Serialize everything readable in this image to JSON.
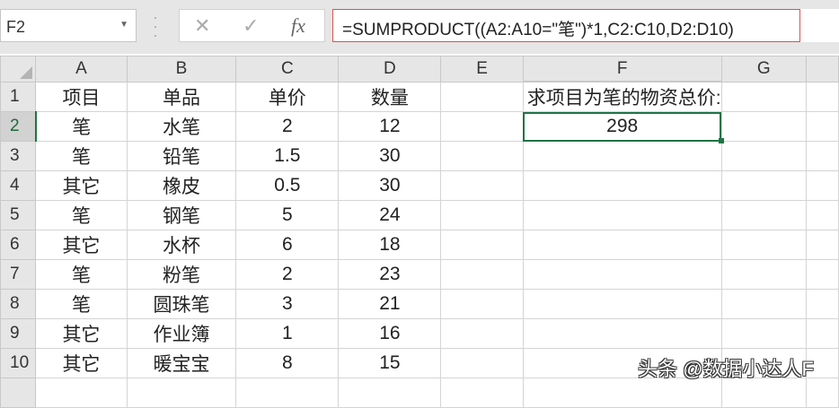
{
  "name_box": "F2",
  "formula_bar": {
    "cancel": "✕",
    "enter": "✓",
    "fx": "fx",
    "formula": "=SUMPRODUCT((A2:A10=\"笔\")*1,C2:C10,D2:D10)"
  },
  "columns": [
    "A",
    "B",
    "C",
    "D",
    "E",
    "F",
    "G",
    ""
  ],
  "rows": [
    [
      "项目",
      "单品",
      "单价",
      "数量",
      "",
      "求项目为笔的物资总价:",
      "",
      ""
    ],
    [
      "笔",
      "水笔",
      "2",
      "12",
      "",
      "298",
      "",
      ""
    ],
    [
      "笔",
      "铅笔",
      "1.5",
      "30",
      "",
      "",
      "",
      ""
    ],
    [
      "其它",
      "橡皮",
      "0.5",
      "30",
      "",
      "",
      "",
      ""
    ],
    [
      "笔",
      "钢笔",
      "5",
      "24",
      "",
      "",
      "",
      ""
    ],
    [
      "其它",
      "水杯",
      "6",
      "18",
      "",
      "",
      "",
      ""
    ],
    [
      "笔",
      "粉笔",
      "2",
      "23",
      "",
      "",
      "",
      ""
    ],
    [
      "笔",
      "圆珠笔",
      "3",
      "21",
      "",
      "",
      "",
      ""
    ],
    [
      "其它",
      "作业簿",
      "1",
      "16",
      "",
      "",
      "",
      ""
    ],
    [
      "其它",
      "暖宝宝",
      "8",
      "15",
      "",
      "",
      "",
      ""
    ],
    [
      "",
      "",
      "",
      "",
      "",
      "",
      "",
      ""
    ]
  ],
  "watermark": "头条 @数据小达人F"
}
